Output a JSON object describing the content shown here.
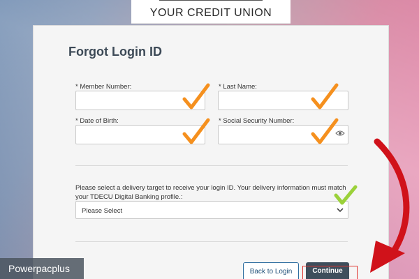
{
  "brand": {
    "tagline": "YOUR CREDIT UNION"
  },
  "form": {
    "title": "Forgot Login ID",
    "fields": [
      {
        "label": "* Member Number:",
        "value": ""
      },
      {
        "label": "* Last Name:",
        "value": ""
      },
      {
        "label": "* Date of Birth:",
        "value": ""
      },
      {
        "label": "* Social Security Number:",
        "value": ""
      }
    ],
    "delivery": {
      "instructions": "Please select a delivery target to receive your login ID. Your delivery information must match your TDECU Digital Banking profile.:",
      "selected": "Please Select"
    },
    "buttons": {
      "back": "Back to Login",
      "continue": "Continue"
    }
  },
  "overlay": {
    "watermark": "Powerpacplus",
    "checkmark_color": "#f5901e",
    "valid_checkmark_color": "#9bd13a",
    "arrow_color": "#d0121a"
  },
  "icons": {
    "password_toggle": "eye-icon",
    "select_chevron": "chevron-down-icon"
  }
}
